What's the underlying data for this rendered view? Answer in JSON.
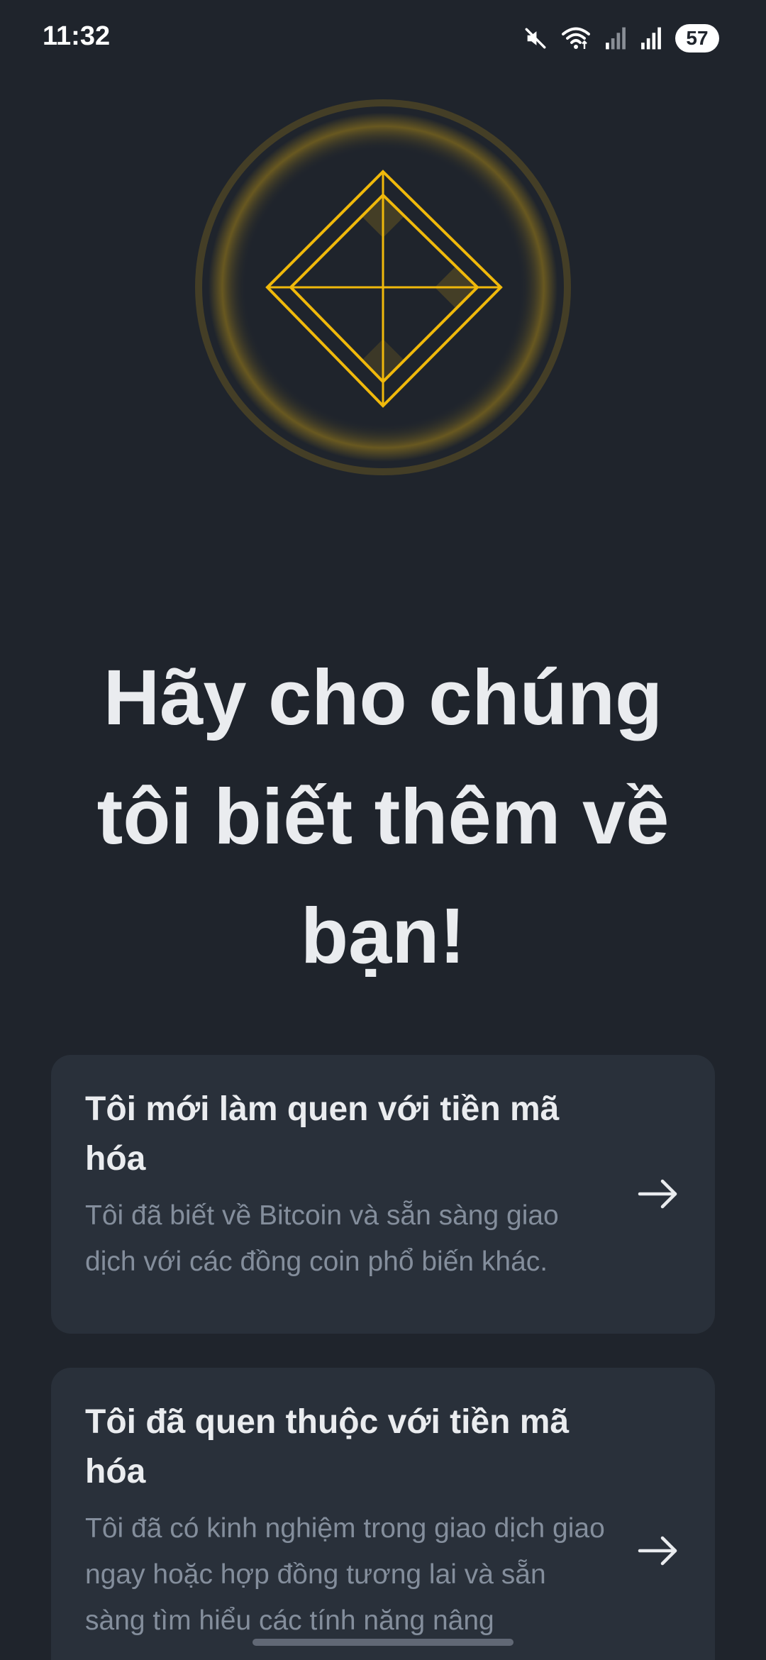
{
  "status_bar": {
    "time": "11:32",
    "battery": "57",
    "icons": [
      "mute-icon",
      "wifi-icon",
      "signal-icon",
      "signal-icon"
    ]
  },
  "hero": {
    "icon": "diamond-icon",
    "accent_color": "#f0b90b"
  },
  "title": "Hãy cho chúng tôi biết thêm về bạn!",
  "options": [
    {
      "title": "Tôi mới làm quen với tiền mã hóa",
      "description": "Tôi đã biết về Bitcoin và sẵn sàng giao dịch với các đồng coin phổ biến khác.",
      "icon": "arrow-right-icon"
    },
    {
      "title": "Tôi đã quen thuộc với tiền mã hóa",
      "description": "Tôi đã có kinh nghiệm trong giao dịch giao ngay hoặc hợp đồng tương lai và sẵn sàng tìm hiểu các tính năng nâng",
      "icon": "arrow-right-icon"
    }
  ],
  "colors": {
    "background": "#1f242c",
    "card": "#29303a",
    "text_primary": "#eaecef",
    "text_secondary": "#848e9c",
    "accent": "#f0b90b"
  }
}
